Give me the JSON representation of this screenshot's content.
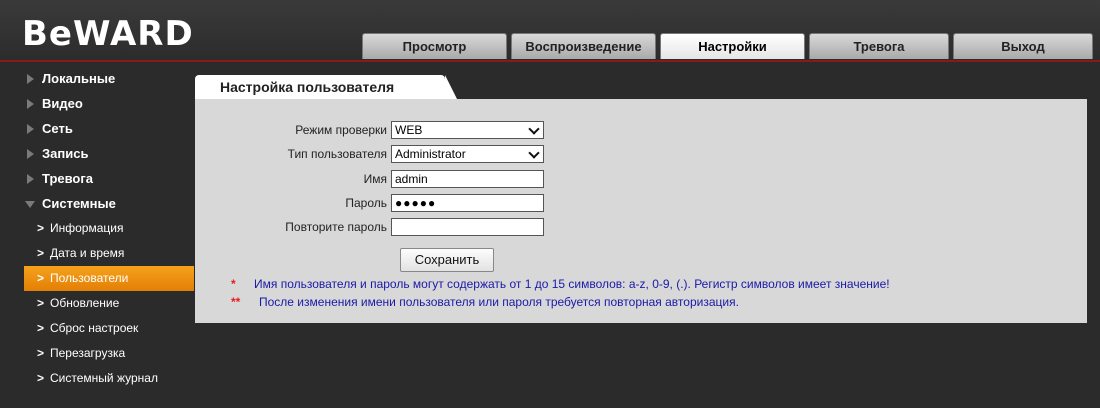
{
  "brand": {
    "logo_text": "BeWARD"
  },
  "nav_tabs": [
    {
      "label": "Просмотр",
      "active": false
    },
    {
      "label": "Воспроизведение",
      "active": false
    },
    {
      "label": "Настройки",
      "active": true
    },
    {
      "label": "Тревога",
      "active": false
    },
    {
      "label": "Выход",
      "active": false
    }
  ],
  "sidebar": {
    "sections": [
      {
        "label": "Локальные"
      },
      {
        "label": "Видео"
      },
      {
        "label": "Сеть"
      },
      {
        "label": "Запись"
      },
      {
        "label": "Тревога"
      },
      {
        "label": "Системные"
      }
    ],
    "system_items": [
      {
        "label": "Информация"
      },
      {
        "label": "Дата и время"
      },
      {
        "label": "Пользователи",
        "active": true
      },
      {
        "label": "Обновление"
      },
      {
        "label": "Сброс настроек"
      },
      {
        "label": "Перезагрузка"
      },
      {
        "label": "Системный журнал"
      }
    ]
  },
  "panel": {
    "title": "Настройка пользователя",
    "fields": {
      "auth_mode": {
        "label": "Режим проверки",
        "value": "WEB"
      },
      "user_type": {
        "label": "Тип пользователя",
        "value": "Administrator"
      },
      "name": {
        "label": "Имя",
        "value": "admin"
      },
      "password": {
        "label": "Пароль",
        "value": "●●●●●"
      },
      "password_repeat": {
        "label": "Повторите пароль",
        "value": ""
      }
    },
    "save_label": "Сохранить",
    "notes": [
      {
        "marker": "*",
        "text": "Имя пользователя и пароль могут содержать от 1 до 15 символов: a-z, 0-9, (.). Регистр символов имеет значение!"
      },
      {
        "marker": "**",
        "text": "После изменения имени пользователя или пароля требуется повторная авторизация."
      }
    ]
  },
  "colors": {
    "background": "#2b2b2b",
    "accent_orange": "#f29316",
    "panel": "#d8d8d8",
    "note_text": "#1a1aa8",
    "note_marker": "#e02020"
  }
}
